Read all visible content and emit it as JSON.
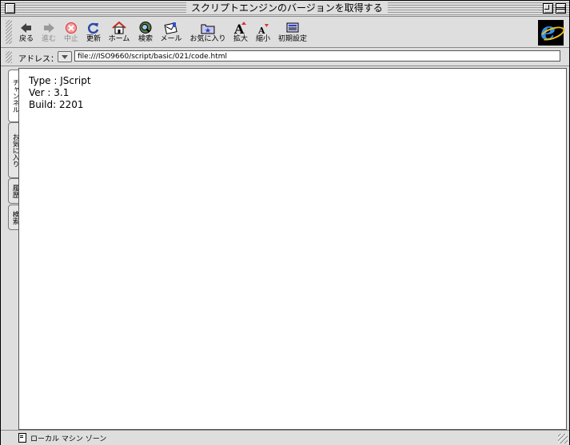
{
  "window": {
    "title": "スクリプトエンジンのバージョンを取得する"
  },
  "toolbar": {
    "buttons": [
      {
        "label": "戻る",
        "icon": "back-arrow-icon",
        "enabled": true
      },
      {
        "label": "進む",
        "icon": "forward-arrow-icon",
        "enabled": false
      },
      {
        "label": "中止",
        "icon": "stop-icon",
        "enabled": false
      },
      {
        "label": "更新",
        "icon": "refresh-icon",
        "enabled": true
      },
      {
        "label": "ホーム",
        "icon": "home-icon",
        "enabled": true
      },
      {
        "label": "検索",
        "icon": "search-icon",
        "enabled": true
      },
      {
        "label": "メール",
        "icon": "mail-icon",
        "enabled": true
      },
      {
        "label": "お気に入り",
        "icon": "favorites-icon",
        "enabled": true
      },
      {
        "label": "拡大",
        "icon": "text-larger-icon",
        "enabled": true
      },
      {
        "label": "縮小",
        "icon": "text-smaller-icon",
        "enabled": true
      },
      {
        "label": "初期設定",
        "icon": "preferences-icon",
        "enabled": true
      }
    ]
  },
  "address": {
    "label": "アドレス：",
    "url": "file:///ISO9660/script/basic/021/code.html"
  },
  "sidetabs": [
    "チャンネル",
    "お気に入り",
    "履歴",
    "検索"
  ],
  "content": {
    "lines": [
      "Type : JScript",
      "Ver : 3.1",
      "Build: 2201"
    ]
  },
  "status": {
    "zone": "ローカル マシン ゾーン"
  },
  "colors": {
    "chrome": "#dedede",
    "stop_red": "#e03030",
    "refresh_blue": "#2a4aa8",
    "ie_blue": "#3a8ee6"
  }
}
